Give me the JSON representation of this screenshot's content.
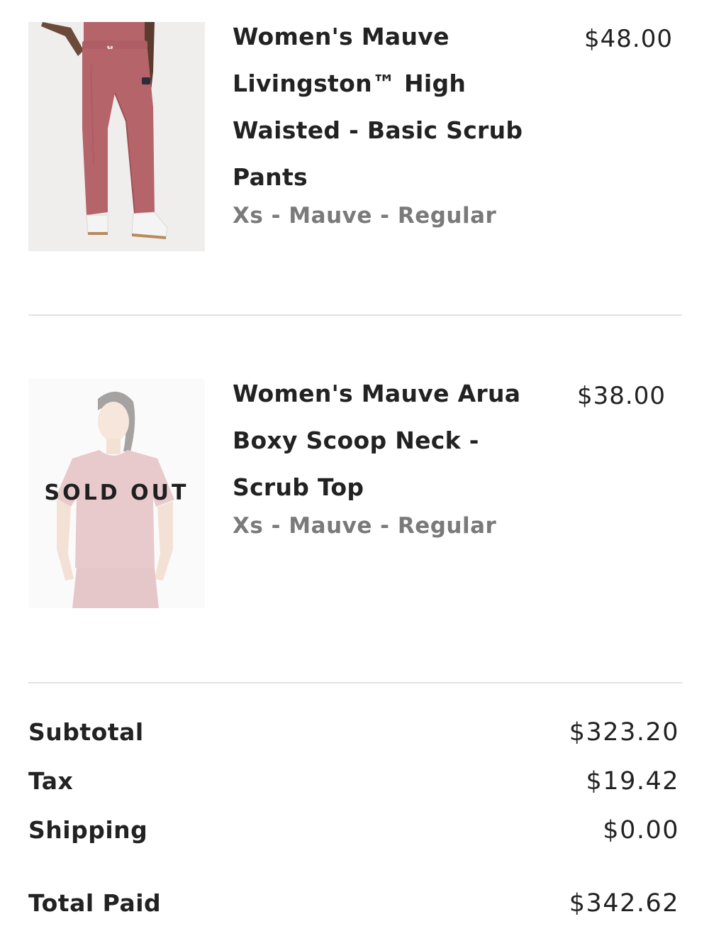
{
  "order_items": [
    {
      "title_lines": [
        "Women's Mauve",
        "Livingston™ High",
        "Waisted - Basic Scrub",
        "Pants"
      ],
      "variant": "Xs - Mauve - Regular",
      "price": "$48.00",
      "image": "scrub-pants-photo",
      "sold_out": false
    },
    {
      "title_lines": [
        "Women's Mauve Arua",
        "Boxy Scoop Neck -",
        "Scrub Top"
      ],
      "variant": "Xs - Mauve - Regular",
      "price": "$38.00",
      "image": "scrub-top-photo",
      "sold_out": true,
      "sold_out_label": "SOLD OUT"
    }
  ],
  "summary": {
    "subtotal_label": "Subtotal",
    "subtotal_value": "$323.20",
    "tax_label": "Tax",
    "tax_value": "$19.42",
    "shipping_label": "Shipping",
    "shipping_value": "$0.00",
    "total_label": "Total Paid",
    "total_value": "$342.62"
  },
  "colors": {
    "product_mauve": "#b5646a",
    "muted_text": "#7a7a7a",
    "divider": "#e2e2e2"
  }
}
